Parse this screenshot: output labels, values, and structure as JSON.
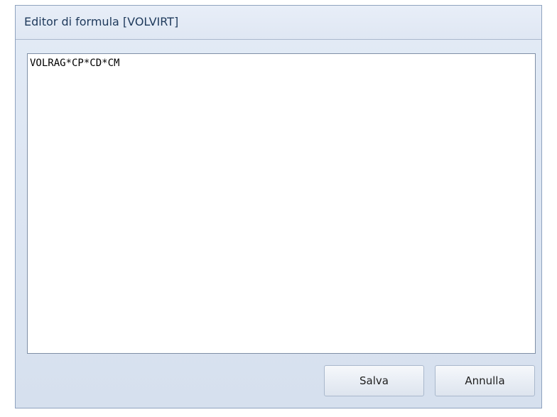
{
  "window": {
    "title": "Editor di formula [VOLVIRT]"
  },
  "editor": {
    "value": "VOLRAG*CP*CD*CM"
  },
  "buttons": {
    "save_label": "Salva",
    "cancel_label": "Annulla"
  },
  "colors": {
    "title_text": "#1e395b",
    "dialog_background": "#dde6f3",
    "border": "#8fa3bf"
  }
}
